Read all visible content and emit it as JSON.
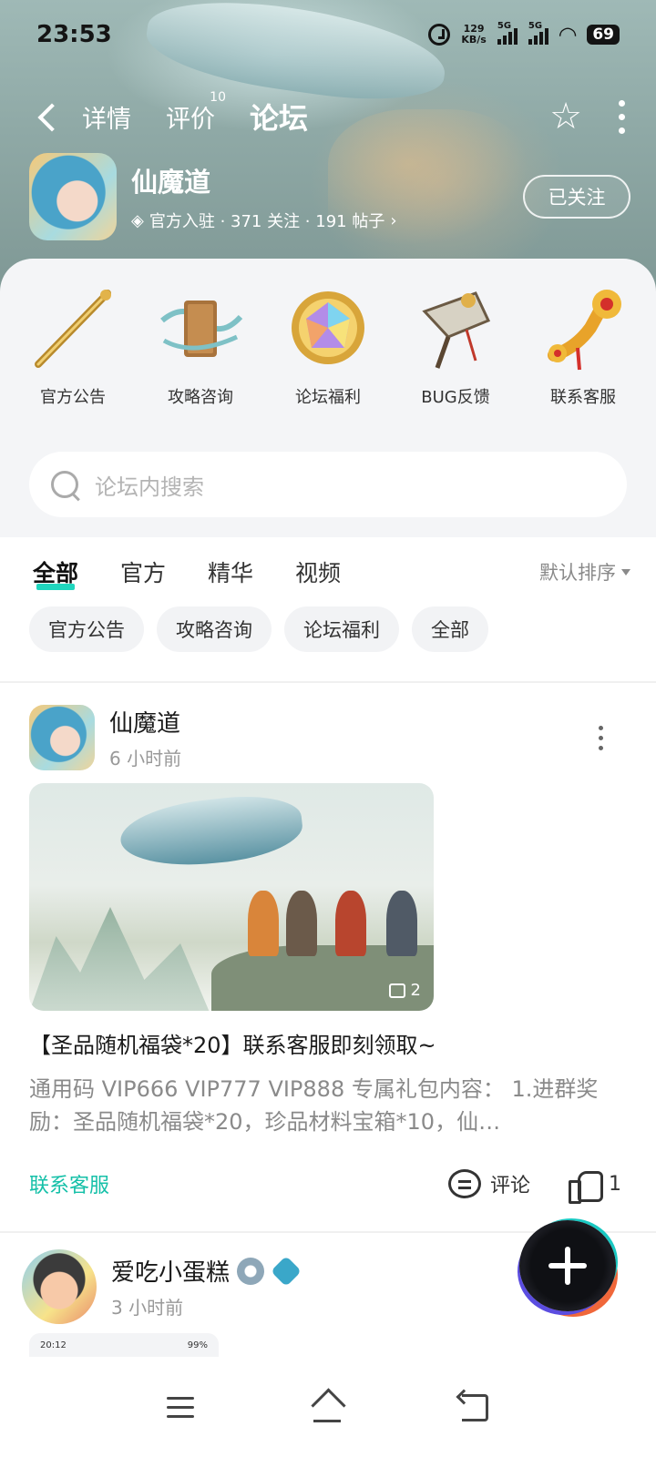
{
  "status_bar": {
    "time": "23:53",
    "speed_value": "129",
    "speed_unit": "KB/s",
    "network1": "5G",
    "network2": "5G",
    "battery": "69"
  },
  "nav": {
    "tabs": [
      {
        "label": "详情"
      },
      {
        "label": "评价",
        "count": "10"
      },
      {
        "label": "论坛"
      }
    ],
    "active_tab": "论坛",
    "accent_color": "#20d6be"
  },
  "game": {
    "name": "仙魔道",
    "meta": "官方入驻 · 371 关注 · 191 帖子",
    "follow_label": "已关注"
  },
  "quick_links": [
    {
      "label": "官方公告",
      "icon": "golden-staff-icon"
    },
    {
      "label": "攻略咨询",
      "icon": "scroll-icon"
    },
    {
      "label": "论坛福利",
      "icon": "rainbow-gem-icon"
    },
    {
      "label": "BUG反馈",
      "icon": "broken-weapon-icon"
    },
    {
      "label": "联系客服",
      "icon": "jade-ruyi-icon"
    }
  ],
  "search": {
    "placeholder": "论坛内搜索"
  },
  "filter": {
    "tabs": [
      "全部",
      "官方",
      "精华",
      "视频"
    ],
    "sort_label": "默认排序"
  },
  "chips": [
    "官方公告",
    "攻略咨询",
    "论坛福利",
    "全部"
  ],
  "post1": {
    "author": "仙魔道",
    "time": "6 小时前",
    "image_count": "2",
    "title": "【圣品随机福袋*20】联系客服即刻领取~",
    "summary": "通用码 VIP666 VIP777 VIP888 专属礼包内容： 1.进群奖励：圣品随机福袋*20，珍品材料宝箱*10，仙…",
    "tag": "联系客服",
    "comment_label": "评论",
    "like_count": "1"
  },
  "post2": {
    "author": "爱吃小蛋糕",
    "time": "3 小时前",
    "thumb_time": "20:12",
    "thumb_battery": "99%"
  }
}
